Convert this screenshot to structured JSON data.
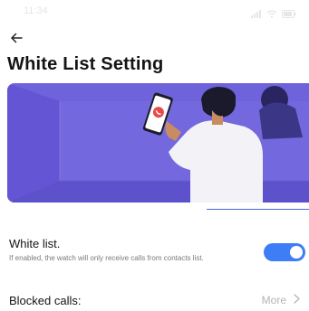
{
  "status_bar": {
    "time": "11:34"
  },
  "header": {
    "back_icon": "back-arrow-icon",
    "title": "White List Setting"
  },
  "banner": {
    "illustration": "person-holding-phone-incoming-call",
    "colors": {
      "background": "#6f63db",
      "floor": "#5e52cc",
      "accent": "#3d7df6"
    }
  },
  "white_list": {
    "title": "White list.",
    "description": "If enabled, the watch will only receive calls from contacts list.",
    "enabled": true
  },
  "blocked_calls": {
    "label": "Blocked calls:",
    "more_label": "More",
    "more_icon": "chevron-right-icon"
  },
  "colors": {
    "toggle_on": "#3d7df6",
    "muted_text": "#7a7a7a"
  }
}
